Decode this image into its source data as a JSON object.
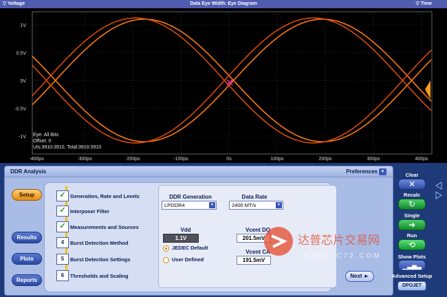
{
  "plot": {
    "header_left": "▽ Voltage",
    "header_center": "Data Eye Width: Eye Diagram",
    "header_right": "▽ Time",
    "y_ticks": [
      "1V",
      "0.5V",
      "0V",
      "-0.5V",
      "-1V"
    ],
    "x_ticks": [
      "-400ps",
      "-300ps",
      "-200ps",
      "-100ps",
      "0s",
      "100ps",
      "200ps",
      "300ps",
      "400ps"
    ],
    "info_eye": "Eye: All Bits",
    "info_offset": "Offset: 0",
    "info_ui": "UIs:3910:3910, Total:3910:3910",
    "colors": {
      "trace": "#ff7a10",
      "trace_dark": "#d84a08",
      "grid": "#555555",
      "marker": "#ff2bd6"
    }
  },
  "ddr": {
    "title": "DDR Analysis",
    "preferences": "Preferences",
    "nav": {
      "setup": "Setup",
      "results": "Results",
      "plots": "Plots",
      "reports": "Reports"
    },
    "steps": [
      {
        "num": "✓",
        "label": "Generation, Rate and Levels",
        "done": true
      },
      {
        "num": "✓",
        "label": "Interposer Filter",
        "done": true
      },
      {
        "num": "✓",
        "label": "Measurements and Sources",
        "done": true
      },
      {
        "num": "4",
        "label": "Burst Detection Method",
        "done": false
      },
      {
        "num": "5",
        "label": "Burst Detection Settings",
        "done": false
      },
      {
        "num": "6",
        "label": "Thresholds and Scaling",
        "done": false
      }
    ],
    "generation_label": "DDR Generation",
    "generation_value": "LPDDR4",
    "rate_label": "Data Rate",
    "rate_value": "2400 MT/s",
    "vdd_label": "Vdd",
    "vdd_value": "1.1V",
    "jedec_default": "JEDEC Default",
    "user_defined": "User Defined",
    "vcent_dq_label": "Vcent DQ",
    "vcent_dq_value": "201.5mV",
    "vcent_ca_label": "Vcent CA",
    "vcent_ca_value": "191.5mV",
    "next": "Next ►"
  },
  "controls": {
    "clear": "Clear",
    "recalc": "Recalc",
    "single": "Single",
    "run": "Run",
    "show_plots": "Show Plots",
    "advanced_setup": "Advanced Setup",
    "dpojet": "DPOJET"
  },
  "watermark": {
    "cn_text": "达普芯片交易网",
    "url": "WWW.IC72.COM"
  }
}
